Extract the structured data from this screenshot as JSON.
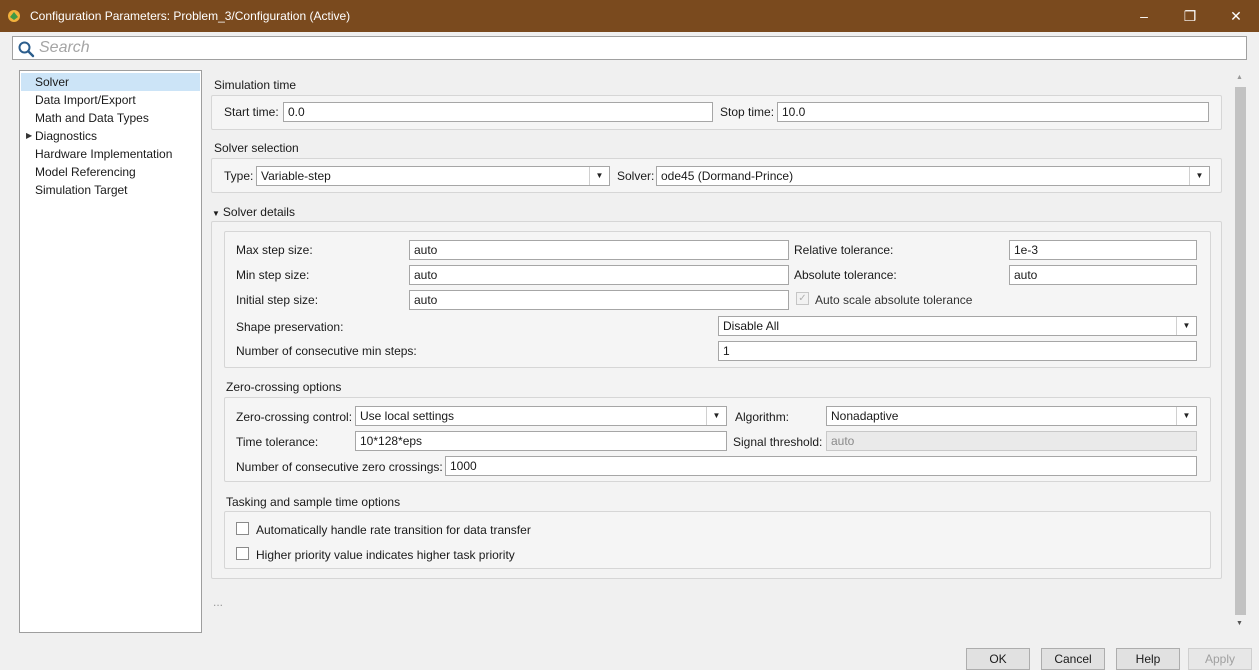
{
  "window": {
    "title": "Configuration Parameters: Problem_3/Configuration (Active)",
    "minimize_label": "–",
    "restore_label": "❐",
    "close_label": "✕"
  },
  "search": {
    "placeholder": "Search"
  },
  "nav": {
    "items": [
      {
        "label": "Solver",
        "selected": true
      },
      {
        "label": "Data Import/Export"
      },
      {
        "label": "Math and Data Types"
      },
      {
        "label": "Diagnostics",
        "expandable": true,
        "expander": "▶"
      },
      {
        "label": "Hardware Implementation"
      },
      {
        "label": "Model Referencing"
      },
      {
        "label": "Simulation Target"
      }
    ]
  },
  "simulation_time": {
    "title": "Simulation time",
    "start_label": "Start time:",
    "start_value": "0.0",
    "stop_label": "Stop time:",
    "stop_value": "10.0"
  },
  "solver_selection": {
    "title": "Solver selection",
    "type_label": "Type:",
    "type_value": "Variable-step",
    "solver_label": "Solver:",
    "solver_value": "ode45 (Dormand-Prince)"
  },
  "solver_details": {
    "title": "Solver details",
    "expander": "▼",
    "max_step_label": "Max step size:",
    "max_step_value": "auto",
    "min_step_label": "Min step size:",
    "min_step_value": "auto",
    "initial_step_label": "Initial step size:",
    "initial_step_value": "auto",
    "rel_tol_label": "Relative tolerance:",
    "rel_tol_value": "1e-3",
    "abs_tol_label": "Absolute tolerance:",
    "abs_tol_value": "auto",
    "auto_scale_label": "Auto scale absolute tolerance",
    "auto_scale_mark": "✓",
    "shape_label": "Shape preservation:",
    "shape_value": "Disable All",
    "consec_min_label": "Number of consecutive min steps:",
    "consec_min_value": "1"
  },
  "zero_crossing": {
    "title": "Zero-crossing options",
    "control_label": "Zero-crossing control:",
    "control_value": "Use local settings",
    "algorithm_label": "Algorithm:",
    "algorithm_value": "Nonadaptive",
    "time_tol_label": "Time tolerance:",
    "time_tol_value": "10*128*eps",
    "signal_thr_label": "Signal threshold:",
    "signal_thr_value": "auto",
    "consec_zc_label": "Number of consecutive zero crossings:",
    "consec_zc_value": "1000"
  },
  "tasking": {
    "title": "Tasking and sample time options",
    "rate_transition_label": "Automatically handle rate transition for data transfer",
    "priority_label": "Higher priority value indicates higher task priority"
  },
  "more_indicator": "...",
  "buttons": {
    "ok": "OK",
    "cancel": "Cancel",
    "help": "Help",
    "apply": "Apply"
  },
  "colors": {
    "titlebar": "#7a4a1e",
    "selection": "#cce4f7"
  }
}
